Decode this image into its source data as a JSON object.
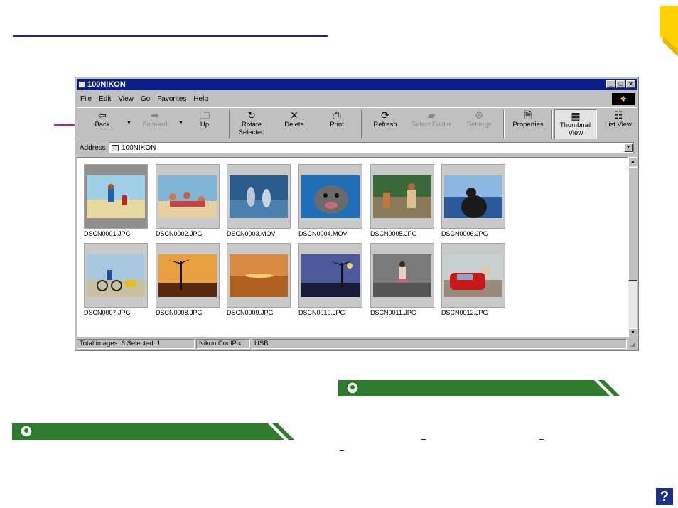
{
  "window": {
    "title": "100NIKON",
    "controls": {
      "minimize": "_",
      "maximize": "□",
      "close": "×"
    }
  },
  "menu": [
    "File",
    "Edit",
    "View",
    "Go",
    "Favorites",
    "Help"
  ],
  "toolbar": {
    "back": "Back",
    "forward": "Forward",
    "up": "Up",
    "rotate_line1": "Rotate",
    "rotate_line2": "Selected",
    "delete": "Delete",
    "print": "Print",
    "refresh": "Refresh",
    "select_folder": "Select Folder",
    "settings": "Settings",
    "properties": "Properties",
    "thumbnail_line1": "Thumbnail",
    "thumbnail_line2": "View",
    "list_view": "List View"
  },
  "address": {
    "label": "Address",
    "value": "100NIKON"
  },
  "thumbnails": [
    {
      "name": "DSCN0001.JPG",
      "selected": true,
      "theme": "beach-kids",
      "icon": "photo-beach-kids-icon"
    },
    {
      "name": "DSCN0002.JPG",
      "selected": false,
      "theme": "beach-group",
      "icon": "photo-beach-group-icon"
    },
    {
      "name": "DSCN0003.MOV",
      "selected": false,
      "theme": "dolphins",
      "icon": "photo-dolphins-icon"
    },
    {
      "name": "DSCN0004.MOV",
      "selected": false,
      "theme": "seal",
      "icon": "photo-seal-icon"
    },
    {
      "name": "DSCN0005.JPG",
      "selected": false,
      "theme": "cafe",
      "icon": "photo-cafe-icon"
    },
    {
      "name": "DSCN0006.JPG",
      "selected": false,
      "theme": "sea-person",
      "icon": "photo-sea-person-icon"
    },
    {
      "name": "DSCN0007.JPG",
      "selected": false,
      "theme": "cyclist",
      "icon": "photo-cyclist-icon"
    },
    {
      "name": "DSCN0008.JPG",
      "selected": false,
      "theme": "palm-sunset",
      "icon": "photo-palm-sunset-icon"
    },
    {
      "name": "DSCN0009.JPG",
      "selected": false,
      "theme": "ocean-sunset",
      "icon": "photo-ocean-sunset-icon"
    },
    {
      "name": "DSCN0010.JPG",
      "selected": false,
      "theme": "palm-dusk",
      "icon": "photo-palm-dusk-icon"
    },
    {
      "name": "DSCN0011.JPG",
      "selected": false,
      "theme": "woman-wall",
      "icon": "photo-woman-wall-icon"
    },
    {
      "name": "DSCN0012.JPG",
      "selected": false,
      "theme": "red-car",
      "icon": "photo-red-car-icon"
    }
  ],
  "status": {
    "images": "Total images: 6   Selected: 1",
    "camera": "Nikon CoolPix",
    "connection": "USB"
  },
  "help_label": "?",
  "colors": {
    "accent_blue": "#1c2f8c",
    "pointer_pink": "#d2187d",
    "tip_green": "#2e7d2e",
    "corner_yellow": "#ffd200"
  }
}
